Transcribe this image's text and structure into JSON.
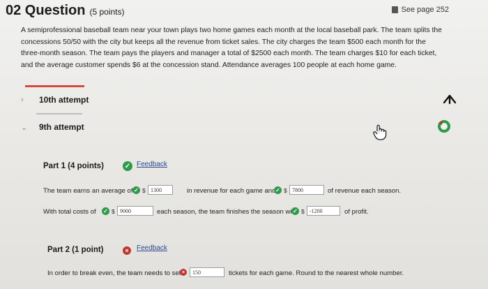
{
  "question": {
    "number": "02 Question",
    "points": "(5 points)",
    "see_page": "See page 252",
    "text": "A semiprofessional baseball team near your town plays two home games each month at the local baseball park. The team splits the concessions 50/50 with the city but keeps all the revenue from ticket sales. The city charges the team $500 each month for the three-month season. The team pays the players and manager a total of $2500 each month. The team charges $10 for each ticket, and the average customer spends $6 at the concession stand. Attendance averages 100 people at each home game."
  },
  "attempts": {
    "tenth": "10th attempt",
    "ninth": "9th attempt"
  },
  "icons": {
    "chevron_right": "›",
    "chevron_down": "⌄"
  },
  "colors": {
    "correct": "#2e9a4a",
    "incorrect": "#c0352f",
    "link": "#2d4a8c",
    "accent_rule": "#d64a3a"
  },
  "part1": {
    "title": "Part 1  (4 points)",
    "feedback": "Feedback",
    "line1_a": "The team earns an average of",
    "field1": "1300",
    "line1_b": "in revenue for each game and",
    "field2": "7800",
    "line1_c": "of revenue each season.",
    "line2_a": "With total costs of",
    "field3": "9000",
    "line2_b": "each season, the team finishes the season with",
    "field4": "-1200",
    "line2_c": "of profit.",
    "currency": "$"
  },
  "part2": {
    "title": "Part 2  (1 point)",
    "feedback": "Feedback",
    "line_a": "In order to break even, the team needs to sell",
    "field": "150",
    "line_b": "tickets for each game. Round to the nearest whole number."
  }
}
